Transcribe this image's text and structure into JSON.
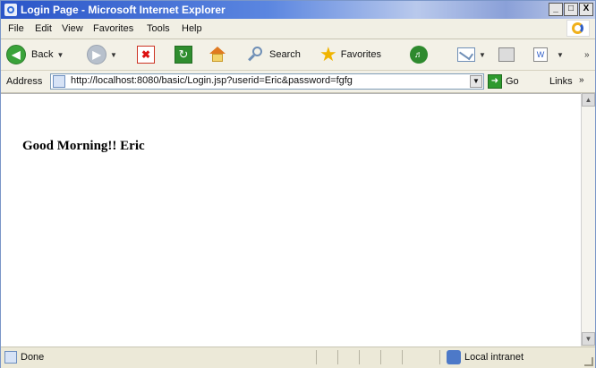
{
  "window": {
    "title": "Login Page - Microsoft Internet Explorer",
    "controls": {
      "minimize": "_",
      "maximize": "□",
      "close": "X"
    }
  },
  "menu": {
    "items": [
      "File",
      "Edit",
      "View",
      "Favorites",
      "Tools",
      "Help"
    ]
  },
  "toolbar": {
    "back_label": "Back",
    "search_label": "Search",
    "favorites_label": "Favorites"
  },
  "address": {
    "label": "Address",
    "url": "http://localhost:8080/basic/Login.jsp?userid=Eric&password=fgfg",
    "go_label": "Go",
    "links_label": "Links"
  },
  "content": {
    "greeting": "Good Morning!! Eric"
  },
  "status": {
    "text": "Done",
    "zone": "Local intranet"
  },
  "colors": {
    "titlebar_start": "#2a55c8",
    "chrome": "#ece9d8",
    "content_bg": "#ffffff"
  },
  "icons": [
    "ie-page-icon",
    "ie-logo-icon",
    "back-arrow-icon",
    "forward-arrow-icon",
    "stop-icon",
    "refresh-icon",
    "home-icon",
    "search-icon",
    "favorites-star-icon",
    "media-icon",
    "mail-icon",
    "print-icon",
    "edit-icon",
    "go-arrow-icon",
    "local-intranet-icon"
  ]
}
